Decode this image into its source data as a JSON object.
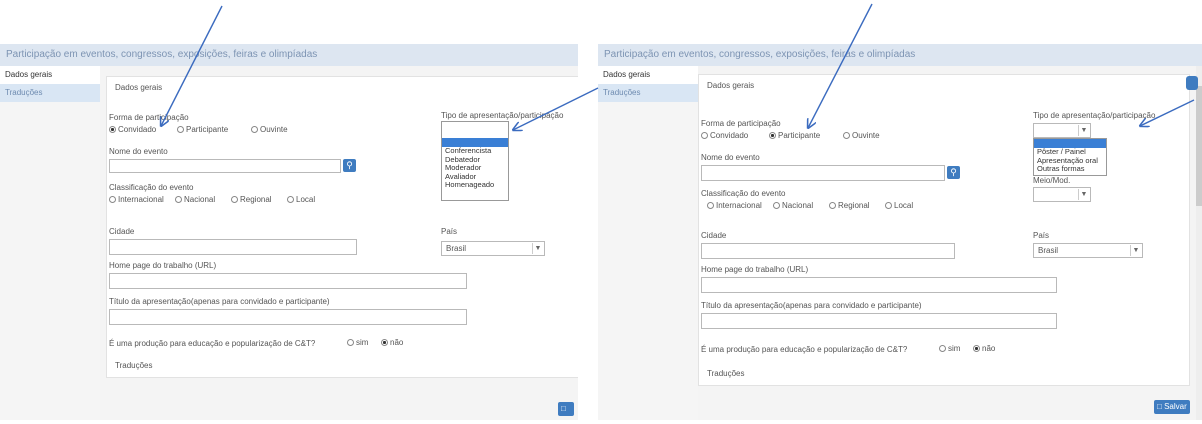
{
  "left": {
    "title": "Participação em eventos, congressos, exposições, feiras e olimpíadas",
    "sidebar": [
      "Dados gerais",
      "Traduções"
    ],
    "section_title": "Dados gerais",
    "forma_label": "Forma de participação",
    "forma_options": [
      "Convidado",
      "Participante",
      "Ouvinte"
    ],
    "forma_selected": "Convidado",
    "tipo_label": "Tipo de apresentação/participação",
    "tipo_options": [
      "",
      "Conferencista",
      "Debatedor",
      "Moderador",
      "Avaliador",
      "Homenageado"
    ],
    "nome_label": "Nome do evento",
    "classif_label": "Classificação do evento",
    "classif_options": [
      "Internacional",
      "Nacional",
      "Regional",
      "Local"
    ],
    "cidade_label": "Cidade",
    "pais_label": "País",
    "pais_value": "Brasil",
    "homepage_label": "Home page do trabalho (URL)",
    "titulo_label": "Título da apresentação(apenas para convidado e participante)",
    "educacao_label": "É uma produção para educação e popularização de C&T?",
    "educacao_options": [
      "sim",
      "não"
    ],
    "educacao_selected": "não",
    "traducoes_label": "Traduções"
  },
  "right": {
    "title": "Participação em eventos, congressos, exposições, feiras e olimpíadas",
    "sidebar": [
      "Dados gerais",
      "Traduções"
    ],
    "section_title": "Dados gerais",
    "forma_label": "Forma de participação",
    "forma_options": [
      "Convidado",
      "Participante",
      "Ouvinte"
    ],
    "forma_selected": "Participante",
    "tipo_label": "Tipo de apresentação/participação",
    "tipo_options": [
      "",
      "Pôster / Painel",
      "Apresentação oral",
      "Outras formas"
    ],
    "meio_label": "Meio/Mod.",
    "nome_label": "Nome do evento",
    "classif_label": "Classificação do evento",
    "classif_options": [
      "Internacional",
      "Nacional",
      "Regional",
      "Local"
    ],
    "cidade_label": "Cidade",
    "pais_label": "País",
    "pais_value": "Brasil",
    "homepage_label": "Home page do trabalho (URL)",
    "titulo_label": "Título da apresentação(apenas para convidado e participante)",
    "educacao_label": "É uma produção para educação e popularização de C&T?",
    "educacao_options": [
      "sim",
      "não"
    ],
    "educacao_selected": "não",
    "traducoes_label": "Traduções",
    "save_label": "Salvar"
  },
  "colors": {
    "arrow": "#3b6bbf",
    "title_bar": "#dde6f1",
    "accent": "#3f7cc0",
    "highlight": "#3a7fd5"
  },
  "icons": {
    "search": "search-icon",
    "save": "save-icon",
    "dropdown": "chevron-down-icon"
  }
}
